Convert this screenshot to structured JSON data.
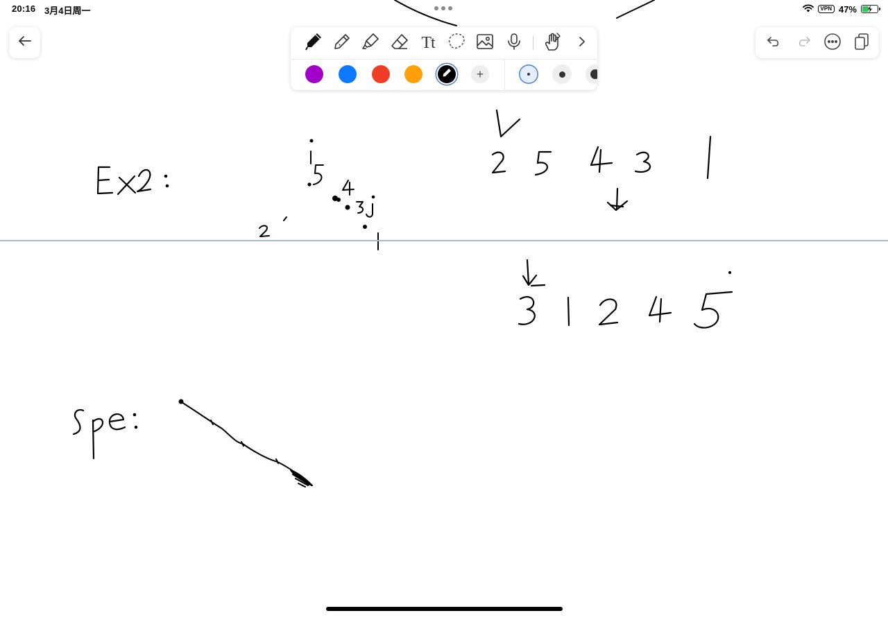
{
  "status_bar": {
    "time": "20:16",
    "date": "3月4日周一",
    "vpn": "VPN",
    "battery_percent_label": "47%",
    "battery_level": 0.47
  },
  "toolbar": {
    "tools": [
      "pen-icon",
      "pencil-icon",
      "highlighter-icon",
      "eraser-icon",
      "text-icon",
      "lasso-icon",
      "image-icon",
      "microphone-icon",
      "touch-hand-icon",
      "chevron-right-icon"
    ],
    "text_tool_label": "Tt",
    "selected_tool": "pen",
    "colors": [
      "#a100c8",
      "#0a78ff",
      "#f03d25",
      "#ff9f0a",
      "#000000"
    ],
    "selected_color": "#000000",
    "add_color": "+",
    "stroke_sizes": [
      "fine",
      "medium",
      "thick"
    ],
    "selected_size": "fine"
  },
  "actions": [
    "undo-icon",
    "redo-icon",
    "more-icon",
    "pages-icon"
  ],
  "page_divider_color": "#a9b8c6"
}
